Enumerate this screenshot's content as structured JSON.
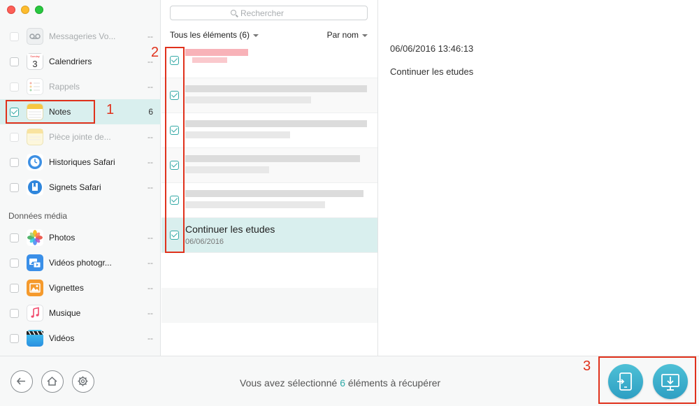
{
  "sidebar": {
    "items": [
      {
        "label": "Messageries Vo...",
        "count": "--",
        "dim": true,
        "checked": false
      },
      {
        "label": "Calendriers",
        "count": "--",
        "dim": false,
        "checked": false
      },
      {
        "label": "Rappels",
        "count": "--",
        "dim": true,
        "checked": false
      },
      {
        "label": "Notes",
        "count": "6",
        "dim": false,
        "checked": true
      },
      {
        "label": "Pièce jointe de...",
        "count": "--",
        "dim": true,
        "checked": false
      },
      {
        "label": "Historiques Safari",
        "count": "--",
        "dim": false,
        "checked": false
      },
      {
        "label": "Signets Safari",
        "count": "--",
        "dim": false,
        "checked": false
      }
    ],
    "section_header": "Données média",
    "media_items": [
      {
        "label": "Photos",
        "count": "--"
      },
      {
        "label": "Vidéos photogr...",
        "count": "--"
      },
      {
        "label": "Vignettes",
        "count": "--"
      },
      {
        "label": "Musique",
        "count": "--"
      },
      {
        "label": "Vidéos",
        "count": "--"
      }
    ]
  },
  "list": {
    "search_placeholder": "Rechercher",
    "filter_label": "Tous les éléments (6)",
    "sort_label": "Par nom",
    "selected_item": {
      "title": "Continuer les etudes",
      "date": "06/06/2016"
    }
  },
  "detail": {
    "datetime": "06/06/2016 13:46:13",
    "text": "Continuer les etudes"
  },
  "bottom": {
    "status_prefix": "Vous avez sélectionné ",
    "status_count": "6",
    "status_suffix": " éléments à récupérer"
  },
  "annotations": {
    "one": "1",
    "two": "2",
    "three": "3"
  },
  "colors": {
    "accent": "#2eaaa7",
    "annotation": "#e0311c",
    "selection": "#d9efee"
  }
}
